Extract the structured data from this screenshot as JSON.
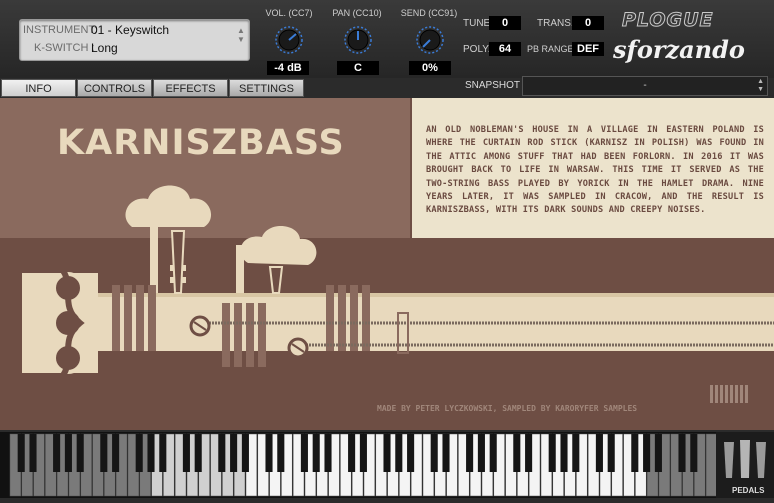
{
  "header": {
    "instrument_label": "INSTRUMENT:",
    "instrument_value": "01 - Keyswitch",
    "kswitch_label": "K-SWITCH :",
    "kswitch_value": "Long",
    "vol": {
      "label": "VOL. (CC7)",
      "value": "-4 dB"
    },
    "pan": {
      "label": "PAN (CC10)",
      "value": "C"
    },
    "send": {
      "label": "SEND (CC91)",
      "value": "0%"
    },
    "tune": {
      "label": "TUNE",
      "value": "0"
    },
    "trans": {
      "label": "TRANS.",
      "value": "0"
    },
    "poly": {
      "label": "POLY.",
      "value": "64"
    },
    "pbrange": {
      "label": "PB RANGE",
      "value": "DEF"
    },
    "logo_top": "PLOGUE",
    "logo_bottom": "sforzando"
  },
  "tabs": [
    "INFO",
    "CONTROLS",
    "EFFECTS",
    "SETTINGS"
  ],
  "snapshot": {
    "label": "SNAPSHOT",
    "value": "-"
  },
  "info": {
    "title": "KARNISZBASS",
    "description": "An old nobleman's house in a village in eastern Poland is where the curtain rod stick (karnisz in Polish) was found in the attic among stuff that had been forlorn. In 2016 it was brought back to life in Warsaw. This time it served as the two-string bass played by Yorick in the Hamlet drama. Nine years later, it was sampled in Cracow, and the result is KarniszBass, with its dark sounds and creepy noises.",
    "credits": "MADE BY PETER LYCZKOWSKI, SAMPLED BY KARORYFER SAMPLES"
  },
  "pedals_label": "PEDALS",
  "colors": {
    "accent_blue": "#3a7cd8",
    "panel_brown": "#6e4e44",
    "panel_cream": "#ece3cc",
    "title_cream": "#e8d9bd"
  }
}
